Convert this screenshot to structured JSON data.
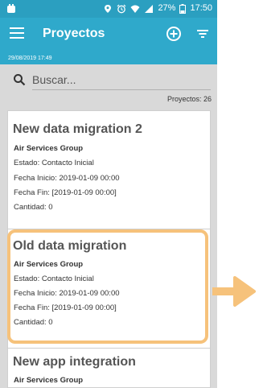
{
  "status_bar": {
    "battery": "27%",
    "time": "17:50",
    "icons": [
      "app-icon",
      "location-icon",
      "alarm-icon",
      "wifi-icon",
      "signal-icon",
      "battery-icon"
    ]
  },
  "app_bar": {
    "title": "Proyectos",
    "date": "29/08/2019 17:49",
    "icons": [
      "menu-icon",
      "add-circle-icon",
      "filter-icon"
    ]
  },
  "search": {
    "placeholder": "Buscar...",
    "icon": "search-icon"
  },
  "count_label": "Proyectos: 26",
  "projects": [
    {
      "title": "New data migration 2",
      "client": "Air Services Group",
      "estado": "Estado: Contacto Inicial",
      "fecha_inicio": "Fecha Inicio: 2019-01-09 00:00",
      "fecha_fin": "Fecha Fin: [2019-01-09 00:00]",
      "cantidad": "Cantidad: 0"
    },
    {
      "title": "Old data migration",
      "client": "Air Services Group",
      "estado": "Estado: Contacto Inicial",
      "fecha_inicio": "Fecha Inicio: 2019-01-09 00:00",
      "fecha_fin": "Fecha Fin: [2019-01-09 00:00]",
      "cantidad": "Cantidad: 0"
    },
    {
      "title": "New app integration",
      "client": "Air Services Group"
    }
  ],
  "annotation": {
    "highlight_color": "#f6c27b",
    "arrow_color": "#f6c27b"
  },
  "colors": {
    "status_bar": "#2b9fc0",
    "app_bar": "#2fa9cb",
    "background": "#d9d9d9"
  }
}
